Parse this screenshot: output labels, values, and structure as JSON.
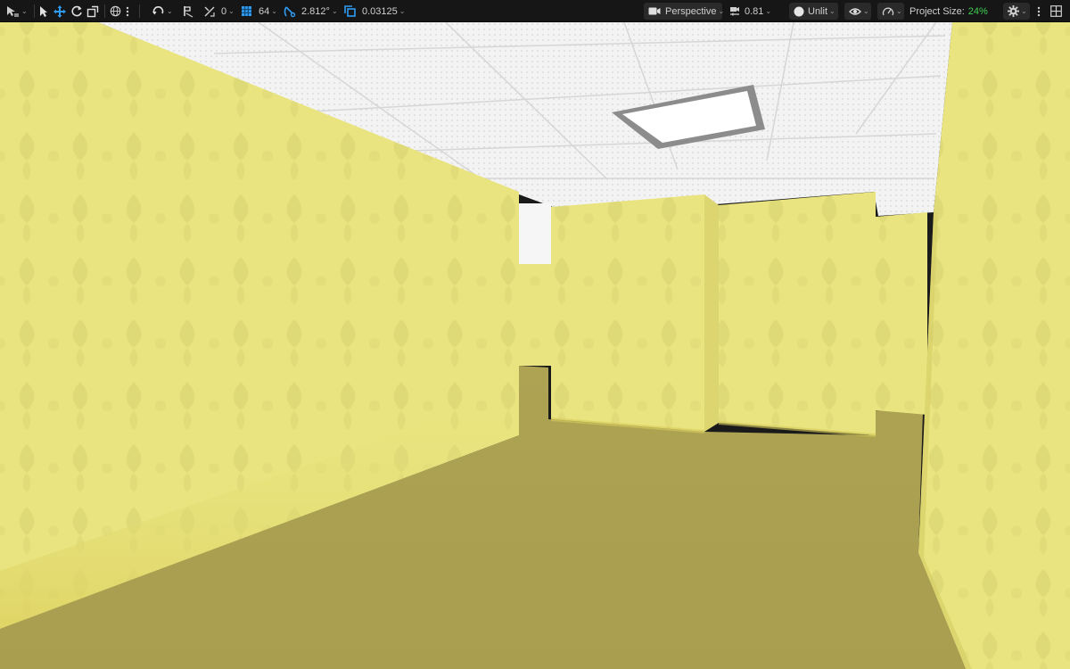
{
  "toolbar": {
    "snap_rotation_value": "0",
    "grid_size_value": "64",
    "rotation_snap_value": "2.812°",
    "scale_snap_value": "0.03125",
    "view_mode_label": "Perspective",
    "camera_speed_value": "0.81",
    "lighting_mode_label": "Unlit",
    "project_size_label": "Project Size:",
    "project_size_value": "24%",
    "icons": {
      "select_mode": "select-mode-icon",
      "select": "cursor-arrow-icon",
      "translate": "move-arrows-icon",
      "rotate": "rotate-icon",
      "scale": "scale-icon",
      "world_local": "globe-icon",
      "surface_snap": "surface-snap-icon",
      "grid_snap": "grid-icon",
      "rotation_snap": "angle-icon",
      "scale_snap": "scale-snap-icon",
      "camera": "video-camera-icon",
      "camera_speed": "camera-speed-icon",
      "unlit": "circle-icon",
      "show": "eye-icon",
      "performance": "gauge-icon",
      "settings": "gear-icon",
      "more": "kebab-icon",
      "layout": "layout-grid-icon"
    }
  },
  "colors": {
    "toolbar_bg": "#161616",
    "accent_blue": "#2f9bf0",
    "project_size_green": "#3fcf50",
    "wall_yellow": "#e8e27f",
    "floor_olive": "#a9a054",
    "ceiling_white": "#f2f2f2"
  }
}
